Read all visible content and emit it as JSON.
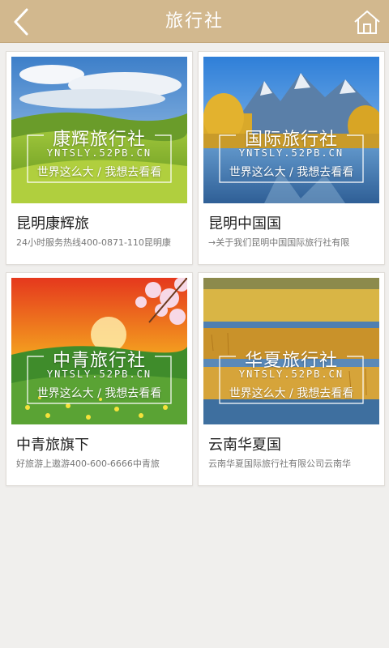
{
  "header": {
    "title": "旅行社",
    "back_icon": "back-arrow-icon",
    "home_icon": "home-icon",
    "background": "#d2b88e"
  },
  "agencies": [
    {
      "name": "昆明康辉旅",
      "description": "24小时服务热线400-0871-110昆明康",
      "image": {
        "title": "康辉旅行社",
        "url": "YNTSLY.52PB.CN",
        "slogan": "世界这么大 / 我想去看看"
      }
    },
    {
      "name": "昆明中国国",
      "description": "→关于我们昆明中国国际旅行社有限",
      "image": {
        "title": "国际旅行社",
        "url": "YNTSLY.52PB.CN",
        "slogan": "世界这么大 / 我想去看看"
      }
    },
    {
      "name": "中青旅旗下",
      "description": "好旅游上遨游400-600-6666中青旅",
      "image": {
        "title": "中青旅行社",
        "url": "YNTSLY.52PB.CN",
        "slogan": "世界这么大 / 我想去看看"
      }
    },
    {
      "name": "云南华夏国",
      "description": "云南华夏国际旅行社有限公司云南华",
      "image": {
        "title": "华夏旅行社",
        "url": "YNTSLY.52PB.CN",
        "slogan": "世界这么大 / 我想去看看"
      }
    }
  ]
}
